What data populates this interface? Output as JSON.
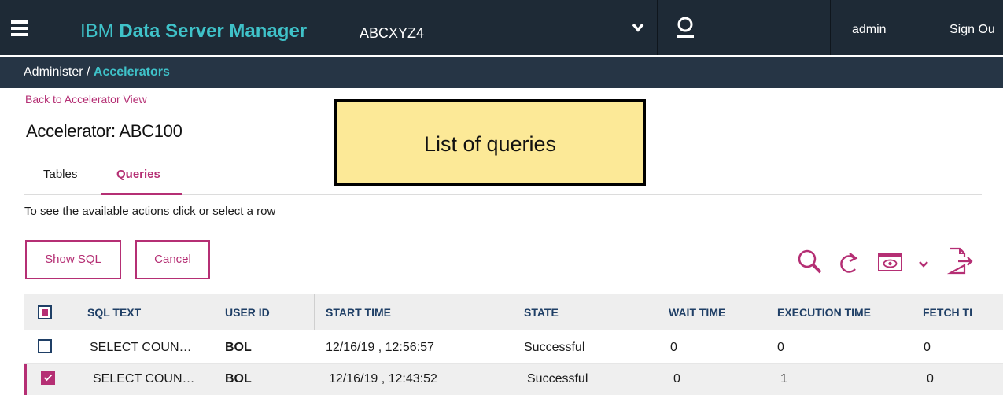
{
  "header": {
    "app_name_prefix": "IBM",
    "app_name_bold": "Data Server Manager",
    "database": "ABCXYZ4",
    "user": "admin",
    "sign_out": "Sign Ou"
  },
  "breadcrumb": {
    "parent": "Administer / ",
    "current": "Accelerators"
  },
  "page": {
    "back_link": "Back to Accelerator View",
    "title": "Accelerator: ABC100",
    "hint": "To see the available actions click or select a row"
  },
  "tabs": [
    {
      "label": "Tables",
      "active": false
    },
    {
      "label": "Queries",
      "active": true
    }
  ],
  "toolbar": {
    "show_sql_label": "Show SQL",
    "cancel_label": "Cancel",
    "icons": [
      "search-icon",
      "refresh-icon",
      "view-columns-icon",
      "chevron-down-icon",
      "export-icon"
    ]
  },
  "callout": {
    "text": "List of queries"
  },
  "table": {
    "columns": [
      "SQL TEXT",
      "USER ID",
      "START TIME",
      "STATE",
      "WAIT TIME",
      "EXECUTION TIME",
      "FETCH TI"
    ],
    "rows": [
      {
        "selected": false,
        "sql_text": "SELECT COUN…",
        "user_id": "BOL",
        "start_time": "12/16/19 , 12:56:57",
        "state": "Successful",
        "wait_time": "0",
        "execution_time": "0",
        "fetch_time": "0"
      },
      {
        "selected": true,
        "sql_text": "SELECT COUN…",
        "user_id": "BOL",
        "start_time": "12/16/19 , 12:43:52",
        "state": "Successful",
        "wait_time": "0",
        "execution_time": "1",
        "fetch_time": "0"
      }
    ]
  },
  "colors": {
    "header_bg": "#1e2a36",
    "accent_teal": "#3fc2c9",
    "accent_magenta": "#b52f74",
    "callout_bg": "#fce997"
  }
}
